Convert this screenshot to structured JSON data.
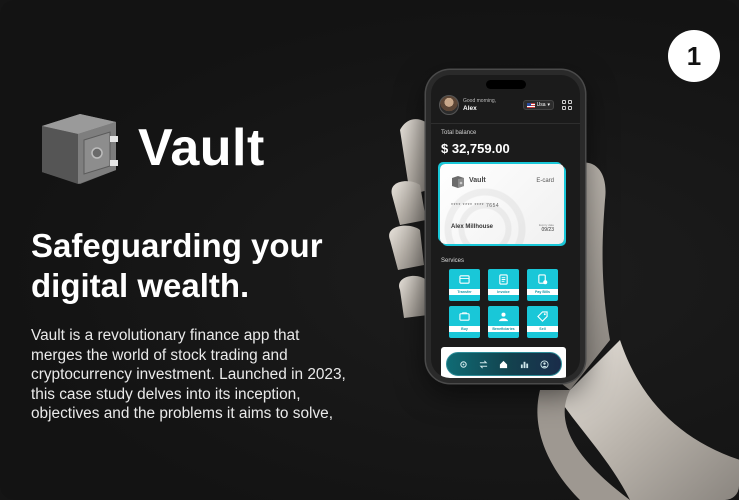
{
  "page_number": "1",
  "brand": {
    "name": "Vault",
    "logo_icon": "safe-icon"
  },
  "headline": "Safeguarding your digital wealth.",
  "description": "Vault is a revolutionary finance app that merges the world of stock trading and cryptocurrency investment. Launched in 2023, this case study delves into its inception, objectives and the problems it aims to solve,",
  "app": {
    "greeting": "Good morning,",
    "user_name": "Alex",
    "currency": "Usa",
    "balance_label": "Total balance",
    "balance_value": "$ 32,759.00",
    "card": {
      "brand": "Vault",
      "type": "E-card",
      "number": "**** **** **** 7654",
      "holder": "Alex Millhouse",
      "expiry_label": "Expiry date",
      "expiry": "09/23"
    },
    "services_title": "Services",
    "services": [
      {
        "label": "Transfer",
        "icon": "transfer-icon"
      },
      {
        "label": "Invoice",
        "icon": "invoice-icon"
      },
      {
        "label": "Pay Bills",
        "icon": "bill-icon"
      },
      {
        "label": "Buy",
        "icon": "buy-icon"
      },
      {
        "label": "Beneficiaries",
        "icon": "beneficiaries-icon"
      },
      {
        "label": "Sell",
        "icon": "tag-icon"
      }
    ],
    "tabs": [
      "settings-icon",
      "transfer-icon",
      "home-icon",
      "chart-icon",
      "profile-icon"
    ]
  },
  "colors": {
    "accent": "#19c7d8",
    "background": "#151515"
  }
}
